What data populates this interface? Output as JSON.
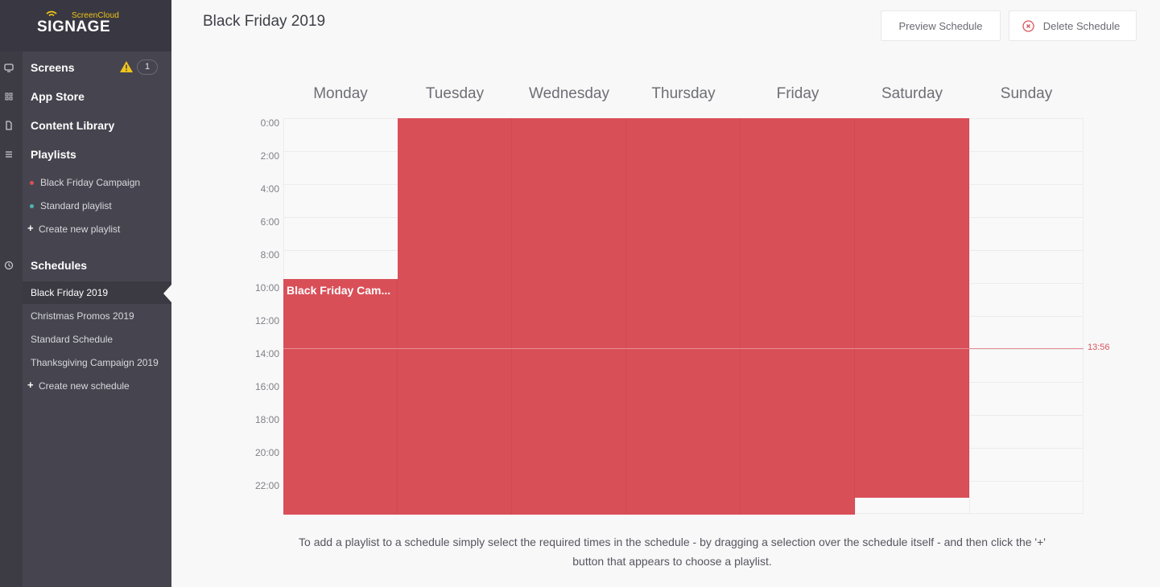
{
  "app": {
    "brand_small": "ScreenCloud",
    "brand_main": "SIGNAGE"
  },
  "sidebar": {
    "nav": [
      {
        "label": "Screens",
        "icon": "monitor-icon",
        "badge": "1",
        "warning": true
      },
      {
        "label": "App Store",
        "icon": "grid-icon"
      },
      {
        "label": "Content Library",
        "icon": "file-icon"
      },
      {
        "label": "Playlists",
        "icon": "list-icon"
      },
      {
        "label": "Schedules",
        "icon": "clock-icon"
      }
    ],
    "playlists": [
      {
        "label": "Black Friday Campaign",
        "color": "#d94f58"
      },
      {
        "label": "Standard playlist",
        "color": "#4fb3b0"
      }
    ],
    "create_playlist": "Create new playlist",
    "schedules": [
      {
        "label": "Black Friday 2019",
        "active": true
      },
      {
        "label": "Christmas Promos 2019"
      },
      {
        "label": "Standard Schedule"
      },
      {
        "label": "Thanksgiving Campaign 2019"
      }
    ],
    "create_schedule": "Create new schedule"
  },
  "header": {
    "title": "Black Friday 2019",
    "preview_button": "Preview Schedule",
    "delete_button": "Delete Schedule"
  },
  "schedule": {
    "days": [
      "Monday",
      "Tuesday",
      "Wednesday",
      "Thursday",
      "Friday",
      "Saturday",
      "Sunday"
    ],
    "time_labels": [
      "0:00",
      "2:00",
      "4:00",
      "6:00",
      "8:00",
      "10:00",
      "12:00",
      "14:00",
      "16:00",
      "18:00",
      "20:00",
      "22:00"
    ],
    "hours_total": 24,
    "event": {
      "playlist": "Black Friday Campaign",
      "label": "Black Friday Cam...",
      "color": "#d94f58",
      "segments": [
        {
          "day": 0,
          "start": 9.75,
          "end": 24
        },
        {
          "day": 1,
          "start": 0,
          "end": 24
        },
        {
          "day": 2,
          "start": 0,
          "end": 24
        },
        {
          "day": 3,
          "start": 0,
          "end": 24
        },
        {
          "day": 4,
          "start": 0,
          "end": 24
        },
        {
          "day": 5,
          "start": 0,
          "end": 23
        }
      ]
    },
    "current_time": "13:56",
    "current_time_hours": 13.933
  },
  "help_text": "To add a playlist to a schedule simply select the required times in the schedule - by dragging a selection over the schedule itself - and then click the '+' button that appears to choose a playlist."
}
